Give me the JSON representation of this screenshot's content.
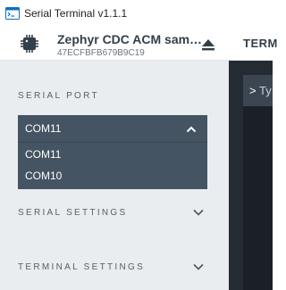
{
  "window": {
    "title": "Serial Terminal v1.1.1",
    "icon": "terminal-app-icon"
  },
  "device": {
    "name": "Zephyr CDC ACM sam…",
    "serial": "47ECFBFB679B9C19",
    "icon": "chip-icon",
    "eject_icon": "eject-icon"
  },
  "tabs": {
    "terminal": "TERM"
  },
  "sidebar": {
    "serial_port": {
      "title": "SERIAL PORT",
      "selected": "COM11",
      "options": [
        "COM11",
        "COM10"
      ]
    },
    "serial_settings": {
      "title": "SERIAL SETTINGS"
    },
    "terminal_settings": {
      "title": "TERMINAL SETTINGS"
    }
  },
  "terminal": {
    "prompt": ">",
    "placeholder": "Ty"
  },
  "colors": {
    "sidebar_bg": "#e9edf0",
    "dropdown_bg": "#445462",
    "terminal_bg": "#252b33"
  }
}
